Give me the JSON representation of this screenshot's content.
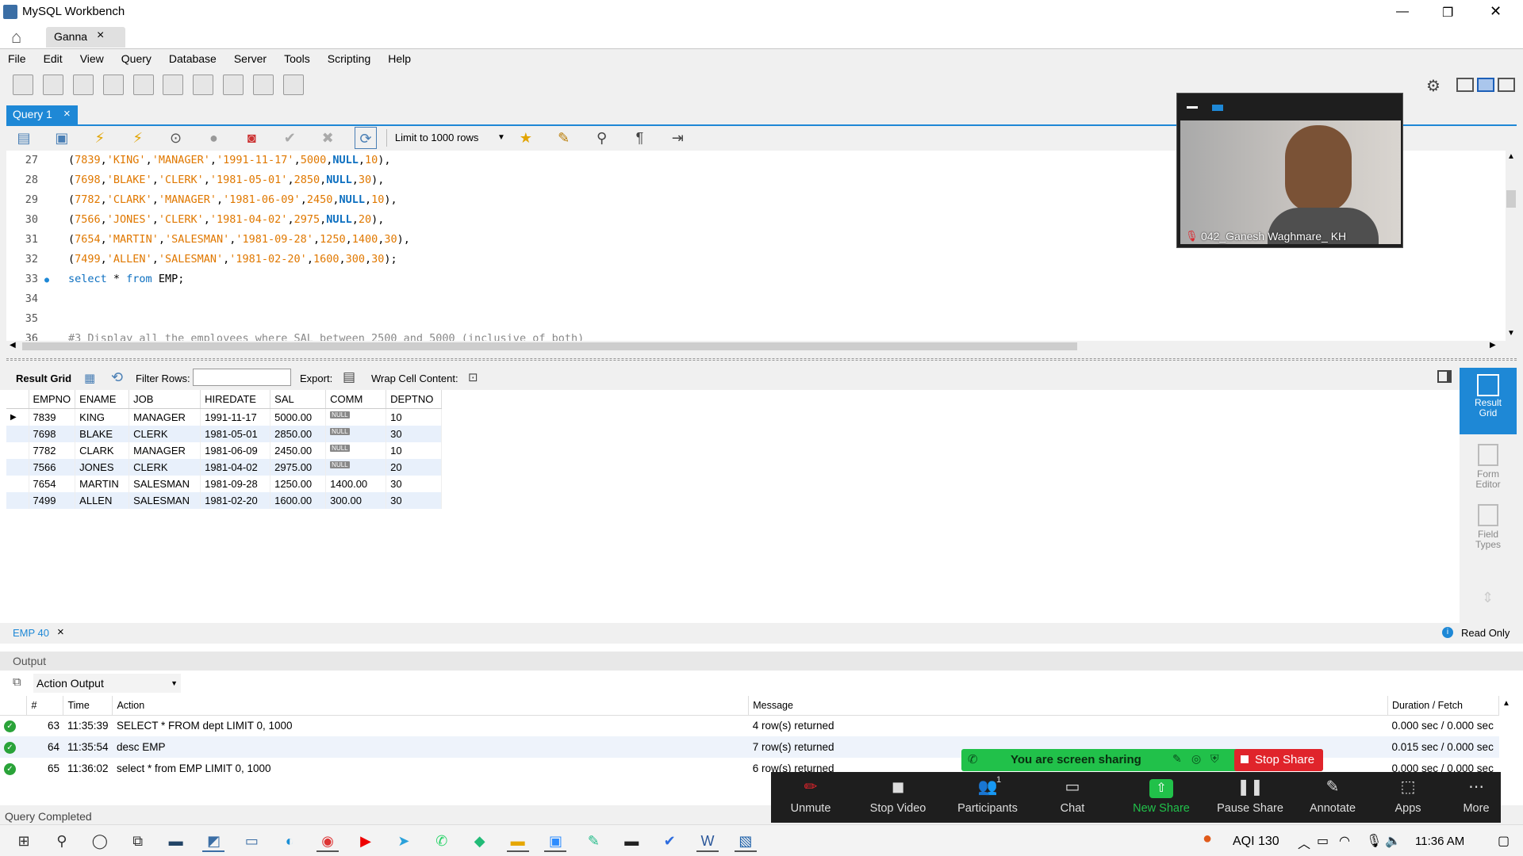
{
  "window": {
    "title": "MySQL Workbench",
    "controls": [
      "—",
      "❐",
      "✕"
    ]
  },
  "tabs": {
    "home_icon": "home-icon",
    "connection_tab": "Ganna",
    "close": "×"
  },
  "menu": [
    "File",
    "Edit",
    "View",
    "Query",
    "Database",
    "Server",
    "Tools",
    "Scripting",
    "Help"
  ],
  "query_tab": {
    "label": "Query 1",
    "close": "×"
  },
  "sql_toolbar": {
    "limit_label": "Limit to 1000 rows"
  },
  "editor": {
    "lines": [
      {
        "n": "27",
        "segs": [
          [
            "p",
            "("
          ],
          [
            "num",
            "7839"
          ],
          [
            "p",
            ","
          ],
          [
            "str",
            "'KING'"
          ],
          [
            "p",
            ","
          ],
          [
            "str",
            "'MANAGER'"
          ],
          [
            "p",
            ","
          ],
          [
            "str",
            "'1991-11-17'"
          ],
          [
            "p",
            ","
          ],
          [
            "num",
            "5000"
          ],
          [
            "p",
            ","
          ],
          [
            "nul",
            "NULL"
          ],
          [
            "p",
            ","
          ],
          [
            "num",
            "10"
          ],
          [
            "p",
            "),"
          ]
        ]
      },
      {
        "n": "28",
        "segs": [
          [
            "p",
            "("
          ],
          [
            "num",
            "7698"
          ],
          [
            "p",
            ","
          ],
          [
            "str",
            "'BLAKE'"
          ],
          [
            "p",
            ","
          ],
          [
            "str",
            "'CLERK'"
          ],
          [
            "p",
            ","
          ],
          [
            "str",
            "'1981-05-01'"
          ],
          [
            "p",
            ","
          ],
          [
            "num",
            "2850"
          ],
          [
            "p",
            ","
          ],
          [
            "nul",
            "NULL"
          ],
          [
            "p",
            ","
          ],
          [
            "num",
            "30"
          ],
          [
            "p",
            "),"
          ]
        ]
      },
      {
        "n": "29",
        "segs": [
          [
            "p",
            "("
          ],
          [
            "num",
            "7782"
          ],
          [
            "p",
            ","
          ],
          [
            "str",
            "'CLARK'"
          ],
          [
            "p",
            ","
          ],
          [
            "str",
            "'MANAGER'"
          ],
          [
            "p",
            ","
          ],
          [
            "str",
            "'1981-06-09'"
          ],
          [
            "p",
            ","
          ],
          [
            "num",
            "2450"
          ],
          [
            "p",
            ","
          ],
          [
            "nul",
            "NULL"
          ],
          [
            "p",
            ","
          ],
          [
            "num",
            "10"
          ],
          [
            "p",
            "),"
          ]
        ]
      },
      {
        "n": "30",
        "segs": [
          [
            "p",
            "("
          ],
          [
            "num",
            "7566"
          ],
          [
            "p",
            ","
          ],
          [
            "str",
            "'JONES'"
          ],
          [
            "p",
            ","
          ],
          [
            "str",
            "'CLERK'"
          ],
          [
            "p",
            ","
          ],
          [
            "str",
            "'1981-04-02'"
          ],
          [
            "p",
            ","
          ],
          [
            "num",
            "2975"
          ],
          [
            "p",
            ","
          ],
          [
            "nul",
            "NULL"
          ],
          [
            "p",
            ","
          ],
          [
            "num",
            "20"
          ],
          [
            "p",
            "),"
          ]
        ]
      },
      {
        "n": "31",
        "segs": [
          [
            "p",
            "("
          ],
          [
            "num",
            "7654"
          ],
          [
            "p",
            ","
          ],
          [
            "str",
            "'MARTIN'"
          ],
          [
            "p",
            ","
          ],
          [
            "str",
            "'SALESMAN'"
          ],
          [
            "p",
            ","
          ],
          [
            "str",
            "'1981-09-28'"
          ],
          [
            "p",
            ","
          ],
          [
            "num",
            "1250"
          ],
          [
            "p",
            ","
          ],
          [
            "num",
            "1400"
          ],
          [
            "p",
            ","
          ],
          [
            "num",
            "30"
          ],
          [
            "p",
            "),"
          ]
        ]
      },
      {
        "n": "32",
        "segs": [
          [
            "p",
            "("
          ],
          [
            "num",
            "7499"
          ],
          [
            "p",
            ","
          ],
          [
            "str",
            "'ALLEN'"
          ],
          [
            "p",
            ","
          ],
          [
            "str",
            "'SALESMAN'"
          ],
          [
            "p",
            ","
          ],
          [
            "str",
            "'1981-02-20'"
          ],
          [
            "p",
            ","
          ],
          [
            "num",
            "1600"
          ],
          [
            "p",
            ","
          ],
          [
            "num",
            "300"
          ],
          [
            "p",
            ","
          ],
          [
            "num",
            "30"
          ],
          [
            "p",
            ");"
          ]
        ]
      },
      {
        "n": "33",
        "segs": [
          [
            "kw",
            "select"
          ],
          [
            "p",
            " * "
          ],
          [
            "kw",
            "from"
          ],
          [
            "p",
            " EMP;"
          ]
        ],
        "marker": "●"
      },
      {
        "n": "34",
        "segs": []
      },
      {
        "n": "35",
        "segs": []
      },
      {
        "n": "36",
        "segs": [
          [
            "cmt",
            "#3 Display all the employees where SAL between 2500 and 5000 (inclusive of both)"
          ]
        ]
      }
    ]
  },
  "result_toolbar": {
    "result_grid": "Result Grid",
    "filter_rows": "Filter Rows:",
    "export": "Export:",
    "wrap": "Wrap Cell Content:"
  },
  "grid": {
    "columns": [
      "EMPNO",
      "ENAME",
      "JOB",
      "HIREDATE",
      "SAL",
      "COMM",
      "DEPTNO"
    ],
    "rows": [
      [
        "7839",
        "KING",
        "MANAGER",
        "1991-11-17",
        "5000.00",
        "NULL",
        "10"
      ],
      [
        "7698",
        "BLAKE",
        "CLERK",
        "1981-05-01",
        "2850.00",
        "NULL",
        "30"
      ],
      [
        "7782",
        "CLARK",
        "MANAGER",
        "1981-06-09",
        "2450.00",
        "NULL",
        "10"
      ],
      [
        "7566",
        "JONES",
        "CLERK",
        "1981-04-02",
        "2975.00",
        "NULL",
        "20"
      ],
      [
        "7654",
        "MARTIN",
        "SALESMAN",
        "1981-09-28",
        "1250.00",
        "1400.00",
        "30"
      ],
      [
        "7499",
        "ALLEN",
        "SALESMAN",
        "1981-02-20",
        "1600.00",
        "300.00",
        "30"
      ]
    ]
  },
  "right_panel": {
    "result_grid": "Result Grid",
    "form_editor": "Form Editor",
    "field_types": "Field Types"
  },
  "result_tab": {
    "label": "EMP 40",
    "close": "×",
    "read_only": "Read Only"
  },
  "output": {
    "header": "Output",
    "selector": "Action Output",
    "columns": [
      "#",
      "Time",
      "Action",
      "Message",
      "Duration / Fetch"
    ],
    "rows": [
      [
        "63",
        "11:35:39",
        "SELECT * FROM dept LIMIT 0, 1000",
        "4 row(s) returned",
        "0.000 sec / 0.000 sec"
      ],
      [
        "64",
        "11:35:54",
        "desc EMP",
        "7 row(s) returned",
        "0.015 sec / 0.000 sec"
      ],
      [
        "65",
        "11:36:02",
        "select * from EMP LIMIT 0, 1000",
        "6 row(s) returned",
        "0.000 sec / 0.000 sec"
      ]
    ]
  },
  "status": "Query Completed",
  "zoom": {
    "video_name": "042_Ganesh Waghmare_ KH",
    "sharing_text": "You are screen sharing",
    "stop_share": "Stop Share",
    "buttons": [
      "Unmute",
      "Stop Video",
      "Participants",
      "Chat",
      "New Share",
      "Pause Share",
      "Annotate",
      "Apps",
      "More"
    ],
    "participants_count": "1"
  },
  "taskbar": {
    "aqi": "AQI 130",
    "time": "11:36 AM"
  },
  "colors": {
    "accent": "#0c6fc0",
    "zoom_bg": "#1e1e1e",
    "share_green": "#21c14a",
    "stop_red": "#e0242b"
  }
}
